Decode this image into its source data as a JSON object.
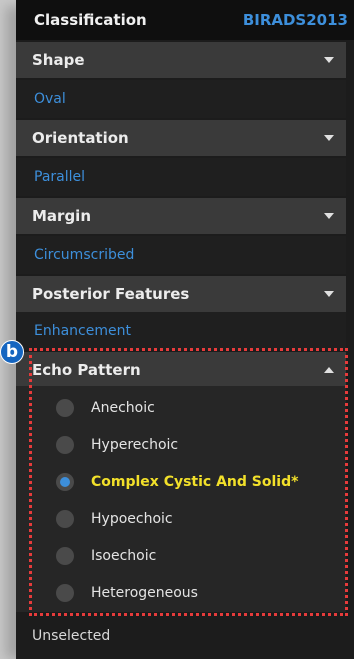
{
  "header": {
    "title": "Classification",
    "standard": "BIRADS2013"
  },
  "sections": [
    {
      "label": "Shape",
      "value": "Oval"
    },
    {
      "label": "Orientation",
      "value": "Parallel"
    },
    {
      "label": "Margin",
      "value": "Circumscribed"
    },
    {
      "label": "Posterior Features",
      "value": "Enhancement"
    }
  ],
  "echo": {
    "label": "Echo Pattern",
    "options": [
      {
        "label": "Anechoic",
        "selected": false
      },
      {
        "label": "Hyperechoic",
        "selected": false
      },
      {
        "label": "Complex Cystic And Solid*",
        "selected": true
      },
      {
        "label": "Hypoechoic",
        "selected": false
      },
      {
        "label": "Isoechoic",
        "selected": false
      },
      {
        "label": "Heterogeneous",
        "selected": false
      }
    ]
  },
  "annotation": {
    "badge": "b"
  },
  "footer": {
    "status": "Unselected"
  },
  "colors": {
    "accent": "#3d8fdb",
    "selected_text": "#f2e02a",
    "highlight": "#e63b3b",
    "badge": "#1565c0"
  }
}
